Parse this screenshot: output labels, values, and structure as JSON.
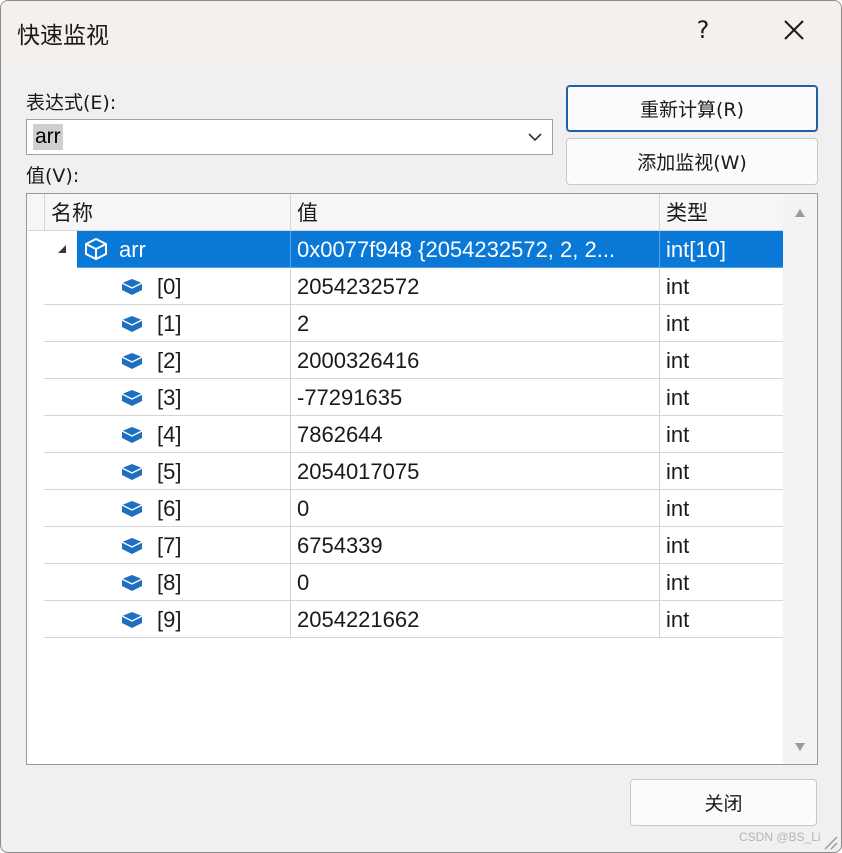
{
  "window": {
    "title": "快速监视",
    "help_glyph": "?",
    "close_icon": "close-icon"
  },
  "expression": {
    "label": "表达式(E):",
    "value": "arr"
  },
  "value_label": "值(V):",
  "buttons": {
    "recalculate": "重新计算(R)",
    "add_watch": "添加监视(W)",
    "close": "关闭"
  },
  "grid": {
    "headers": {
      "name": "名称",
      "value": "值",
      "type": "类型"
    },
    "root": {
      "name": "arr",
      "value": "0x0077f948 {2054232572, 2, 2...",
      "type": "int[10]"
    },
    "items": [
      {
        "name": "[0]",
        "value": "2054232572",
        "type": "int"
      },
      {
        "name": "[1]",
        "value": "2",
        "type": "int"
      },
      {
        "name": "[2]",
        "value": "2000326416",
        "type": "int"
      },
      {
        "name": "[3]",
        "value": "-77291635",
        "type": "int"
      },
      {
        "name": "[4]",
        "value": "7862644",
        "type": "int"
      },
      {
        "name": "[5]",
        "value": "2054017075",
        "type": "int"
      },
      {
        "name": "[6]",
        "value": "0",
        "type": "int"
      },
      {
        "name": "[7]",
        "value": "6754339",
        "type": "int"
      },
      {
        "name": "[8]",
        "value": "0",
        "type": "int"
      },
      {
        "name": "[9]",
        "value": "2054221662",
        "type": "int"
      }
    ]
  },
  "watermark": "CSDN @BS_Li",
  "colors": {
    "selection": "#0a78d7",
    "element_icon": "#1f6fc0",
    "default_button_border": "#1f5fa8"
  }
}
